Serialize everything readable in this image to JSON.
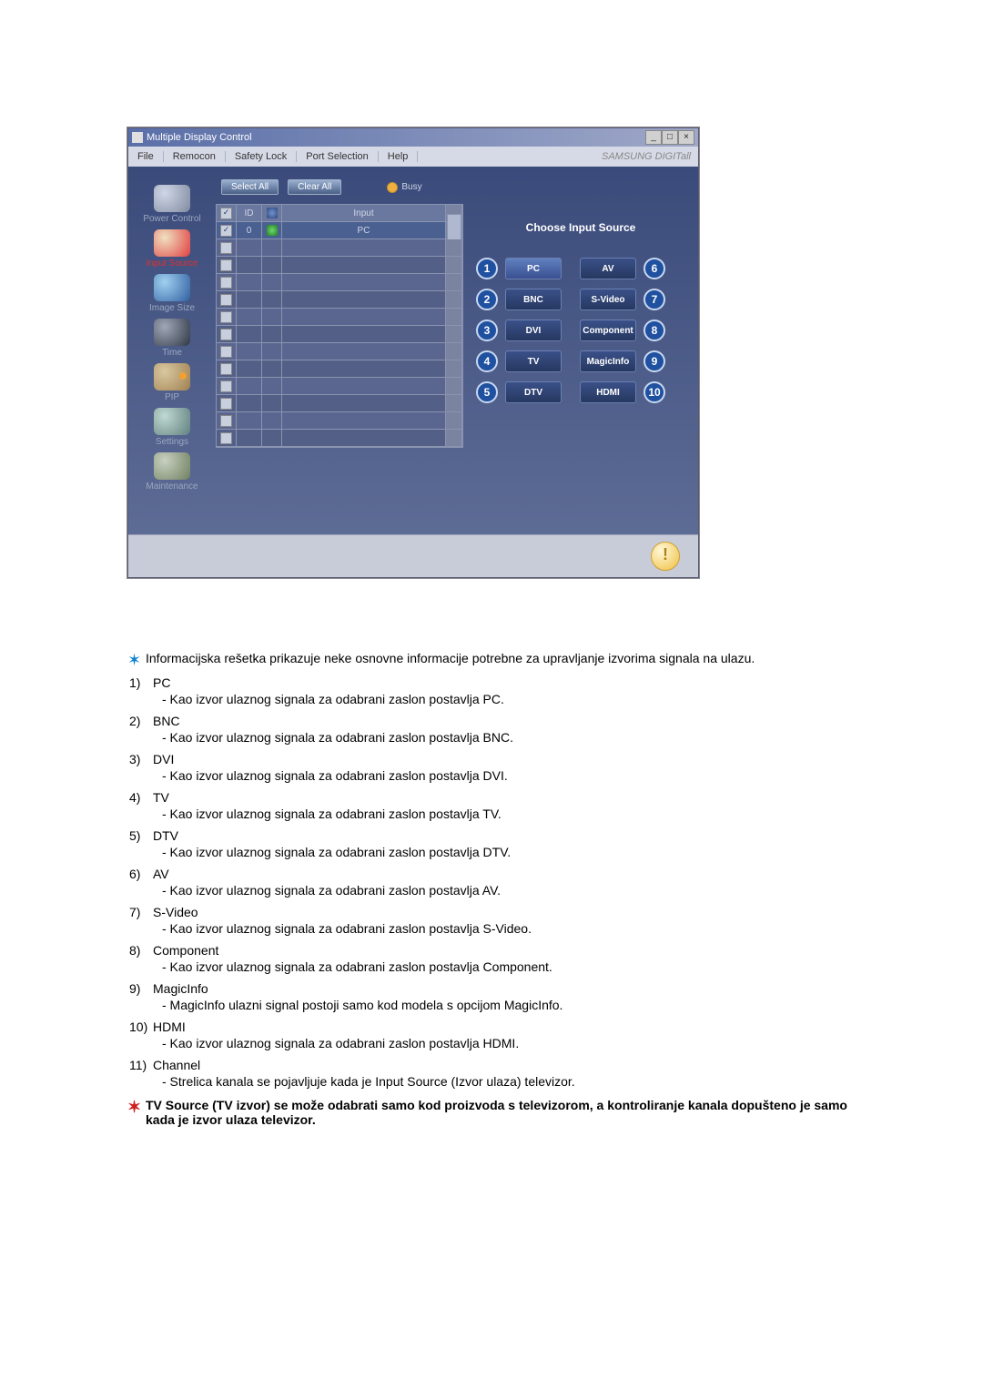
{
  "window": {
    "title": "Multiple Display Control",
    "brand": "SAMSUNG DIGITall",
    "menus": [
      "File",
      "Remocon",
      "Safety Lock",
      "Port Selection",
      "Help"
    ]
  },
  "sidebar": [
    {
      "name": "power-control",
      "label": "Power Control"
    },
    {
      "name": "input-source",
      "label": "Input Source"
    },
    {
      "name": "image-size",
      "label": "Image Size"
    },
    {
      "name": "time",
      "label": "Time"
    },
    {
      "name": "pip",
      "label": "PIP"
    },
    {
      "name": "settings",
      "label": "Settings"
    },
    {
      "name": "maintenance",
      "label": "Maintenance"
    }
  ],
  "toolbar": {
    "select_all": "Select All",
    "clear_all": "Clear All",
    "busy": "Busy"
  },
  "grid": {
    "head": {
      "id": "ID",
      "input": "Input"
    },
    "row0": {
      "id": "0",
      "input": "PC"
    }
  },
  "choose": {
    "title": "Choose Input Source",
    "left": [
      {
        "n": "1",
        "label": "PC"
      },
      {
        "n": "2",
        "label": "BNC"
      },
      {
        "n": "3",
        "label": "DVI"
      },
      {
        "n": "4",
        "label": "TV"
      },
      {
        "n": "5",
        "label": "DTV"
      }
    ],
    "right": [
      {
        "n": "6",
        "label": "AV"
      },
      {
        "n": "7",
        "label": "S-Video"
      },
      {
        "n": "8",
        "label": "Component"
      },
      {
        "n": "9",
        "label": "MagicInfo"
      },
      {
        "n": "10",
        "label": "HDMI"
      }
    ]
  },
  "notes": {
    "intro": "Informacijska rešetka prikazuje neke osnovne informacije potrebne za upravljanje izvorima signala na ulazu.",
    "items": [
      {
        "n": "1)",
        "t": "PC",
        "d": "- Kao izvor ulaznog signala za odabrani zaslon postavlja PC."
      },
      {
        "n": "2)",
        "t": "BNC",
        "d": "- Kao izvor ulaznog signala za odabrani zaslon postavlja BNC."
      },
      {
        "n": "3)",
        "t": "DVI",
        "d": "- Kao izvor ulaznog signala za odabrani zaslon postavlja DVI."
      },
      {
        "n": "4)",
        "t": "TV",
        "d": "- Kao izvor ulaznog signala za odabrani zaslon postavlja TV."
      },
      {
        "n": "5)",
        "t": "DTV",
        "d": "- Kao izvor ulaznog signala za odabrani zaslon postavlja DTV."
      },
      {
        "n": "6)",
        "t": "AV",
        "d": "- Kao izvor ulaznog signala za odabrani zaslon postavlja AV."
      },
      {
        "n": "7)",
        "t": "S-Video",
        "d": "- Kao izvor ulaznog signala za odabrani zaslon postavlja S-Video."
      },
      {
        "n": "8)",
        "t": "Component",
        "d": "- Kao izvor ulaznog signala za odabrani zaslon postavlja Component."
      },
      {
        "n": "9)",
        "t": "MagicInfo",
        "d": "- MagicInfo ulazni signal postoji samo kod modela s opcijom MagicInfo."
      },
      {
        "n": "10)",
        "t": "HDMI",
        "d": "- Kao izvor ulaznog signala za odabrani zaslon postavlja HDMI."
      },
      {
        "n": "11)",
        "t": "Channel",
        "d": "- Strelica kanala se pojavljuje kada je Input Source (Izvor ulaza) televizor."
      }
    ],
    "final": "TV Source (TV izvor) se može odabrati samo kod proizvoda s televizorom, a kontroliranje kanala dopušteno je samo kada je izvor ulaza televizor."
  }
}
